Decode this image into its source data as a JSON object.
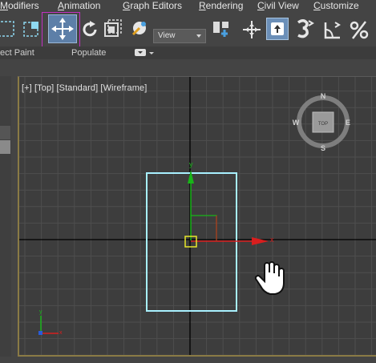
{
  "menu": {
    "items": [
      "Modifiers",
      "Animation",
      "Graph Editors",
      "Rendering",
      "Civil View",
      "Customize"
    ]
  },
  "toolbar": {
    "reference_coordinate_system": "View"
  },
  "ribbon": {
    "labels": [
      "ect Paint",
      "Populate"
    ]
  },
  "viewport": {
    "label": "[+] [Top] [Standard] [Wireframe]",
    "viewcube": {
      "face": "TOP",
      "north": "N",
      "south": "S",
      "east": "E",
      "west": "W"
    },
    "gizmo_axes": {
      "x": "x",
      "y": "y"
    },
    "colors": {
      "background": "#3d3d3d",
      "grid": "#4e4e4e",
      "world_axes": "#000000",
      "selection_box": "#a8f0ff",
      "x_axis": "#d81e1e",
      "y_axis": "#18b518",
      "pivot_box": "#e8e82a",
      "frame": "#8a7a45"
    }
  },
  "icons": [
    "select-region-icon",
    "window-crossing-icon",
    "move-icon",
    "rotate-icon",
    "scale-icon",
    "placement-icon",
    "pick-pivot-icon",
    "transform-center-icon",
    "snap-3d-icon",
    "angle-snap-icon",
    "percent-snap-icon",
    "hand-cursor-icon"
  ]
}
